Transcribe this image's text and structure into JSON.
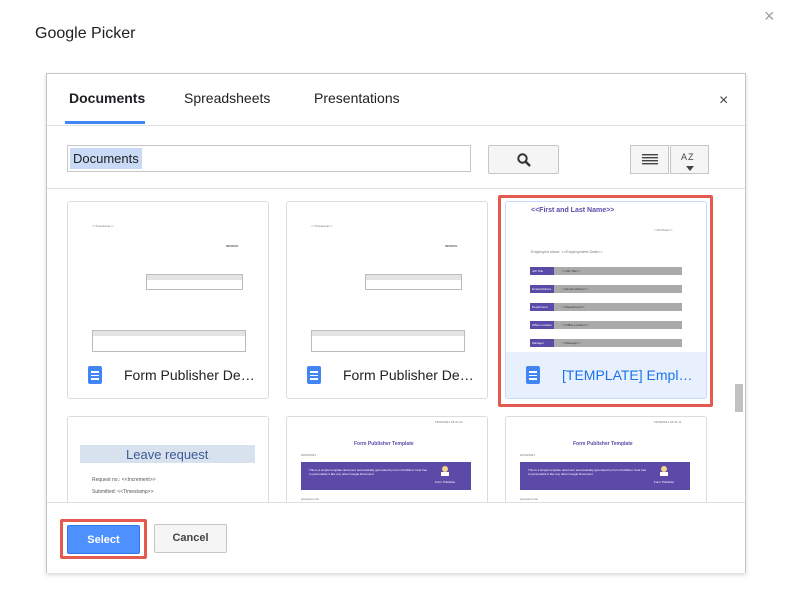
{
  "window": {
    "title": "Google Picker",
    "close_symbol": "×"
  },
  "dialog": {
    "close_symbol": "×"
  },
  "tabs": [
    {
      "label": "Documents",
      "active": true
    },
    {
      "label": "Spreadsheets",
      "active": false
    },
    {
      "label": "Presentations",
      "active": false
    }
  ],
  "search": {
    "token": "Documents"
  },
  "view_controls": {
    "list_view_icon": "list-icon",
    "sort_icon": "sort-az-icon",
    "sort_label": "AZ"
  },
  "documents": [
    {
      "title": "Form Publisher Dem...",
      "selected": false,
      "thumb": {
        "date": "<<Timestamp>>",
        "heading": "INVOICE"
      }
    },
    {
      "title": "Form Publisher Dem...",
      "selected": false,
      "thumb": {
        "date": "<<Timestamp>>",
        "heading": "INVOICE"
      }
    },
    {
      "title": "[TEMPLATE] Employ...",
      "selected": true,
      "thumb": {
        "name": "<<First and Last Name>>",
        "id": "<<ID Photo>>",
        "since": "Employed since: <<Employment Date>>",
        "rows": [
          {
            "label": "Job Title",
            "value": "<<Job Title>>"
          },
          {
            "label": "Email Address",
            "value": "<<Email Address>>"
          },
          {
            "label": "Department",
            "value": "<<Department>>"
          },
          {
            "label": "Office Location",
            "value": "<<Office Location>>"
          },
          {
            "label": "Manager",
            "value": "<<Manager>>"
          }
        ]
      }
    },
    {
      "title": "",
      "selected": false,
      "thumb": {
        "heading": "Leave request",
        "line1": "Request no.: <<Increment>>",
        "line2": "Submitted: <<Timestamp>>"
      }
    },
    {
      "title": "",
      "selected": false,
      "thumb": {
        "date": "15/06/2021 18:31:44",
        "date2": "20/06/2021",
        "heading": "Form Publisher Template",
        "banner": "This is a simple template document automatically generated by Form Publisher. Feel free to personalize it like any other Google Document",
        "logo_label": "Form Publisher",
        "sub": "Questions list"
      }
    },
    {
      "title": "",
      "selected": false,
      "thumb": {
        "date": "15/06/2021 18:31:11",
        "date2": "20/06/2021",
        "heading": "Form Publisher Template",
        "banner": "This is a simple template document automatically generated by Form Publisher. Feel free to personalize it like any other Google Document",
        "logo_label": "Form Publisher",
        "sub": "Questions list"
      }
    }
  ],
  "buttons": {
    "select": "Select",
    "cancel": "Cancel"
  },
  "colors": {
    "accent": "#4285f4",
    "highlight": "#e55a4e",
    "purple": "#5b4aa8",
    "select_button": "#4d90fe"
  }
}
